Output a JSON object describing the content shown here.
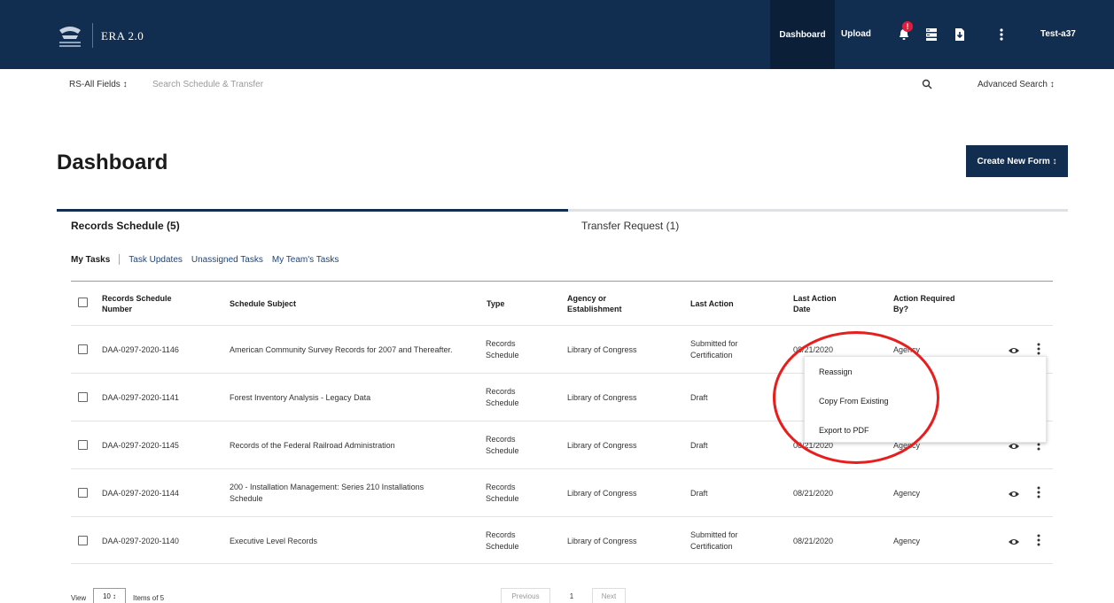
{
  "header": {
    "app_name": "ERA 2.0",
    "nav_dashboard": "Dashboard",
    "nav_upload": "Upload",
    "notification_badge": "!",
    "user": "Test-a37"
  },
  "search": {
    "field_select": "RS-All Fields ↕",
    "placeholder": "Search Schedule & Transfer",
    "advanced": "Advanced Search ↕"
  },
  "page": {
    "title": "Dashboard",
    "create_button": "Create New Form ↕"
  },
  "tabs": [
    {
      "label": "Records Schedule (5)",
      "active": true
    },
    {
      "label": "Transfer Request (1)",
      "active": false
    }
  ],
  "subtabs": [
    {
      "label": "My Tasks",
      "active": true
    },
    {
      "label": "Task Updates",
      "active": false
    },
    {
      "label": "Unassigned Tasks",
      "active": false
    },
    {
      "label": "My Team's Tasks",
      "active": false
    }
  ],
  "table": {
    "headers": {
      "number": [
        "Records Schedule",
        "Number"
      ],
      "subject": [
        "Schedule Subject"
      ],
      "type": [
        "Type"
      ],
      "agency": [
        "Agency or",
        "Establishment"
      ],
      "last_action": [
        "Last Action"
      ],
      "date": [
        "Last Action",
        "Date"
      ],
      "required": [
        "Action Required",
        "By?"
      ]
    },
    "rows": [
      {
        "number": "DAA-0297-2020-1146",
        "subject": [
          "American Community Survey Records for 2007 and Thereafter."
        ],
        "type": [
          "Records",
          "Schedule"
        ],
        "agency": "Library of Congress",
        "last_action": [
          "Submitted for",
          "Certification"
        ],
        "date": "08/21/2020",
        "required": "Agency"
      },
      {
        "number": "DAA-0297-2020-1141",
        "subject": [
          "Forest Inventory Analysis - Legacy Data"
        ],
        "type": [
          "Records",
          "Schedule"
        ],
        "agency": "Library of Congress",
        "last_action": [
          "Draft"
        ],
        "date": "",
        "required": ""
      },
      {
        "number": "DAA-0297-2020-1145",
        "subject": [
          "Records of the Federal Railroad Administration"
        ],
        "type": [
          "Records",
          "Schedule"
        ],
        "agency": "Library of Congress",
        "last_action": [
          "Draft"
        ],
        "date": "08/21/2020",
        "required": "Agency"
      },
      {
        "number": "DAA-0297-2020-1144",
        "subject": [
          "200 - Installation Management: Series 210 Installations",
          "Schedule"
        ],
        "type": [
          "Records",
          "Schedule"
        ],
        "agency": "Library of Congress",
        "last_action": [
          "Draft"
        ],
        "date": "08/21/2020",
        "required": "Agency"
      },
      {
        "number": "DAA-0297-2020-1140",
        "subject": [
          "Executive Level Records"
        ],
        "type": [
          "Records",
          "Schedule"
        ],
        "agency": "Library of Congress",
        "last_action": [
          "Submitted for",
          "Certification"
        ],
        "date": "08/21/2020",
        "required": "Agency"
      }
    ]
  },
  "row_menu": {
    "items": [
      "Reassign",
      "Copy From Existing",
      "Export to PDF"
    ]
  },
  "footer": {
    "view_label": "View",
    "page_size": "10 ↕",
    "items_of": "Items of 5",
    "previous": "Previous",
    "page": "1",
    "next": "Next"
  },
  "colors": {
    "navy": "#112e51",
    "highlight": "#e81d1d"
  }
}
